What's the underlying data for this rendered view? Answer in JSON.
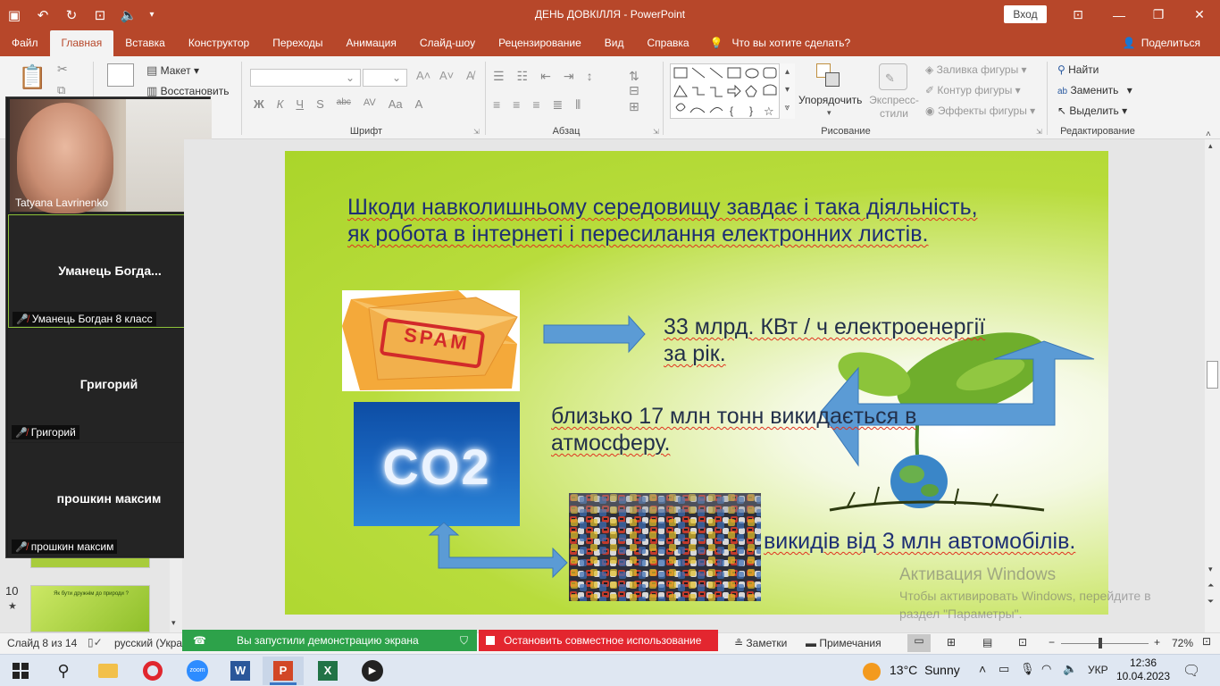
{
  "window": {
    "title": "ДЕНЬ ДОВКІЛЛЯ  -  PowerPoint",
    "signin_label": "Вход",
    "minimize_glyph": "—",
    "maximize_glyph": "❐",
    "close_glyph": "✕",
    "ribbon_display_glyph": "⊡"
  },
  "ribbon": {
    "tabs": [
      "Файл",
      "Главная",
      "Вставка",
      "Конструктор",
      "Переходы",
      "Анимация",
      "Слайд-шоу",
      "Рецензирование",
      "Вид",
      "Справка"
    ],
    "active_tab": "Главная",
    "search_label": "Что вы хотите сделать?",
    "share_label": "Поделиться",
    "slides_group": {
      "layout": "Макет",
      "reset": "Восстановить"
    },
    "font_group_label": "Шрифт",
    "font_buttons": [
      "Ж",
      "К",
      "Ч",
      "S",
      "abc",
      "AV",
      "Aa",
      "A",
      "A"
    ],
    "paragraph_group_label": "Абзац",
    "drawing_group_label": "Рисование",
    "arrange_label": "Упорядочить",
    "quick_styles_label": "Экспресс-стили",
    "shape_fill": "Заливка фигуры",
    "shape_outline": "Контур фигуры",
    "shape_effects": "Эффекты фигуры",
    "editing_group_label": "Редактирование",
    "find": "Найти",
    "replace": "Заменить",
    "select": "Выделить"
  },
  "zoom": {
    "participants": [
      {
        "name": "Tatyana Lavrinenko",
        "display": "",
        "muted": false
      },
      {
        "name": "Уманець Богдан 8 класс",
        "display": "Уманець  Богда...",
        "muted": true
      },
      {
        "name": "Григорий",
        "display": "Григорий",
        "muted": true
      },
      {
        "name": "прошкин максим",
        "display": "прошкин максим",
        "muted": true
      }
    ],
    "share_status": "Вы запустили демонстрацию экрана",
    "stop_share": "Остановить совместное использование"
  },
  "thumbnails": {
    "slide10_number": "10",
    "slide10_star": "★",
    "slide10_title": "Як бути дружнім до природи ?"
  },
  "slide": {
    "heading_line1_parts": [
      "Шкоди навколишньому середовищу завдає і така діяльність,"
    ],
    "heading_line2": "як робота в інтернеті і пересилання електронних листів.",
    "spam_label": "SPAM",
    "co2_label": "CO2",
    "stat1_line1": "33 млрд. КВт / ч електроенергії",
    "stat1_line2": "за рік.",
    "stat2_line1": "близько 17 млн тонн викидається в",
    "stat2_line2": "атмосферу.",
    "stat3": "викидів від 3 млн автомобілів."
  },
  "watermark": {
    "title": "Активация Windows",
    "line1": "Чтобы активировать Windows, перейдите в",
    "line2": "раздел \"Параметры\"."
  },
  "status": {
    "slide_counter": "Слайд 8 из 14",
    "language": "русский (Укра",
    "notes": "Заметки",
    "comments": "Примечания",
    "zoom_level": "72%",
    "zoom_fraction": 0.45
  },
  "taskbar": {
    "apps": [
      "windows-start",
      "search",
      "file-explorer",
      "opera",
      "zoom",
      "word",
      "powerpoint",
      "excel",
      "media-player"
    ],
    "active_app": "powerpoint",
    "weather_temp": "13°C",
    "weather_text": "Sunny",
    "lang": "УКР",
    "time": "12:36",
    "date": "10.04.2023"
  },
  "colors": {
    "powerpoint_red": "#b7472a",
    "slide_green": "#aad52a",
    "heading_blue": "#1e2f73",
    "arrow_blue": "#5b9bd5",
    "share_green": "#2da24a",
    "share_red": "#e3262f"
  }
}
